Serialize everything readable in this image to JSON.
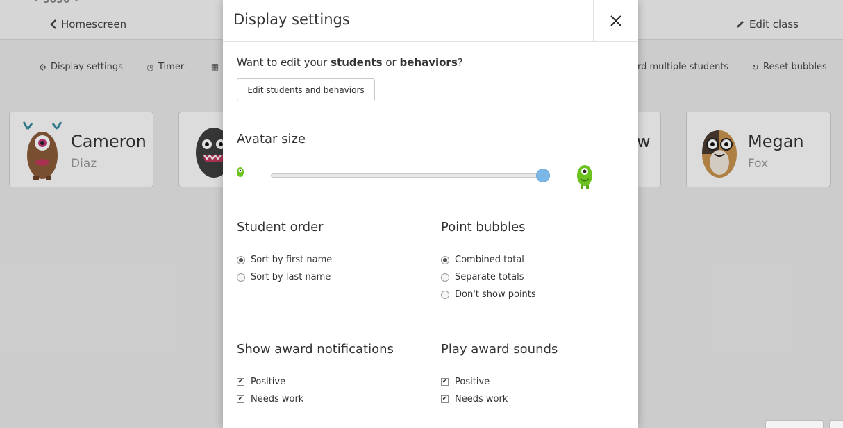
{
  "background": {
    "home_label": "Homescreen",
    "edit_label": "Edit class",
    "toolbar": {
      "display_settings": "Display settings",
      "timer": "Timer",
      "award_multiple_partial": "rd multiple students",
      "reset_bubbles": "Reset bubbles"
    },
    "students": [
      {
        "first": "Cameron",
        "last": "Diaz"
      },
      {
        "first": "",
        "last": ""
      },
      {
        "first": "w",
        "last": ""
      },
      {
        "first": "Megan",
        "last": "Fox"
      }
    ]
  },
  "modal": {
    "title": "Display settings",
    "intro_prefix": "Want to edit your ",
    "intro_students": "students",
    "intro_or": " or ",
    "intro_behaviors": "behaviors",
    "intro_suffix": "?",
    "edit_button": "Edit students and behaviors",
    "avatar_size": {
      "title": "Avatar size",
      "value_percent": 100
    },
    "student_order": {
      "title": "Student order",
      "options": [
        "Sort by first name",
        "Sort by last name"
      ],
      "selected_index": 0
    },
    "point_bubbles": {
      "title": "Point bubbles",
      "options": [
        "Combined total",
        "Separate totals",
        "Don't show points"
      ],
      "selected_index": 0
    },
    "award_notifications": {
      "title": "Show award notifications",
      "options": [
        {
          "label": "Positive",
          "checked": true
        },
        {
          "label": "Needs work",
          "checked": true
        }
      ]
    },
    "award_sounds": {
      "title": "Play award sounds",
      "options": [
        {
          "label": "Positive",
          "checked": true
        },
        {
          "label": "Needs work",
          "checked": true
        }
      ]
    }
  },
  "colors": {
    "slider_thumb": "#7ab7e6",
    "monster_green": "#6cc21f"
  }
}
